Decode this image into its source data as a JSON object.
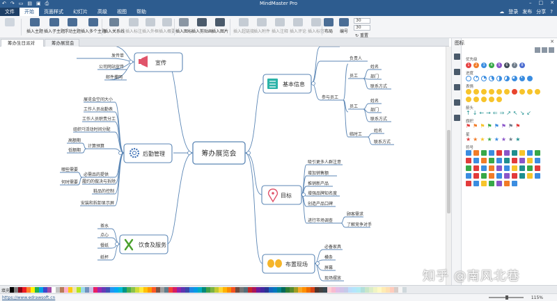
{
  "window": {
    "title": "MindMaster Pro"
  },
  "menu": {
    "items": [
      "文件",
      "开始",
      "页面样式",
      "幻灯片",
      "高级",
      "视图",
      "帮助"
    ],
    "login": "登录",
    "publish": "发布",
    "share": "分享"
  },
  "ribbon": {
    "buttons": [
      "插入主题",
      "插入子主题",
      "浮动主题",
      "插入多个主题",
      "插入关系线",
      "插入标注",
      "插入外框",
      "插入概要",
      "插入图标",
      "插入剪贴画",
      "插入图片",
      "插入超链接",
      "插入附件",
      "插入注释",
      "插入评论",
      "插入标签",
      "布局",
      "编号"
    ],
    "spin_a": "30",
    "spin_b": "30",
    "reset_label": "重置"
  },
  "tabs": [
    {
      "label": "筹办生日派对",
      "active": true
    },
    {
      "label": "筹办展览会",
      "active": false
    }
  ],
  "mindmap": {
    "central": "筹办展览会",
    "topics": {
      "publicity": {
        "title": "宣传",
        "items": [
          "发传单",
          "公司网站宣传",
          "邮件撒网"
        ]
      },
      "logistics": {
        "title": "后勤管理",
        "items": [
          "展览会空间大小",
          "工作人员出勤表",
          "工作人员职责分工",
          "组织각活动时间分配",
          "计算预算",
          "必需品的提供",
          "履约的做决与拆除",
          "鞋品的控制",
          "安装和拆卸显示屏"
        ],
        "budget_children": [
          "高额期",
          "低额期"
        ],
        "supplies_children": [
          "哪些需要",
          "何时需要"
        ]
      },
      "catering": {
        "title": "饮食及服务",
        "items": [
          "茶水",
          "点心",
          "餐纸",
          "纸杯"
        ]
      },
      "basic": {
        "title": "基本信息",
        "items": [
          "负责人",
          "参与员工"
        ],
        "staff_groups": [
          {
            "label": "员工",
            "children": [
              "姓名",
              "部门",
              "联系方式"
            ]
          },
          {
            "label": "员工",
            "children": [
              "姓名",
              "部门",
              "联系方式"
            ]
          },
          {
            "label": "临时工",
            "children": [
              "姓名",
              "联系方式"
            ]
          }
        ]
      },
      "goals": {
        "title": "目标",
        "items": [
          "吸引更多人群注意",
          "增加销售额",
          "推销新产品",
          "增强品牌知名度",
          "创造产品口碑",
          "进行市场调查"
        ],
        "survey_children": [
          "顾客需求",
          "了解竞争对手"
        ]
      },
      "venue": {
        "title": "布置现场",
        "items": [
          "必备家具",
          "横条",
          "屏幕",
          "现场摆放"
        ]
      }
    }
  },
  "panel": {
    "title": "图标",
    "sections": [
      "优先级",
      "进度",
      "表情",
      "箭头",
      "旗帜",
      "星",
      "符号"
    ],
    "priority_numbers": [
      "1",
      "2",
      "3",
      "4",
      "5",
      "6",
      "7",
      "8"
    ]
  },
  "palette": {
    "label": "填充"
  },
  "status": {
    "url": "https://www.edrawsoft.cn",
    "zoom": "115%"
  },
  "watermark": "知乎 @南风北巷",
  "colors": {
    "accent": "#2d5c8f",
    "branch": "#5b86b5",
    "topic_border": "#5b86b5"
  }
}
